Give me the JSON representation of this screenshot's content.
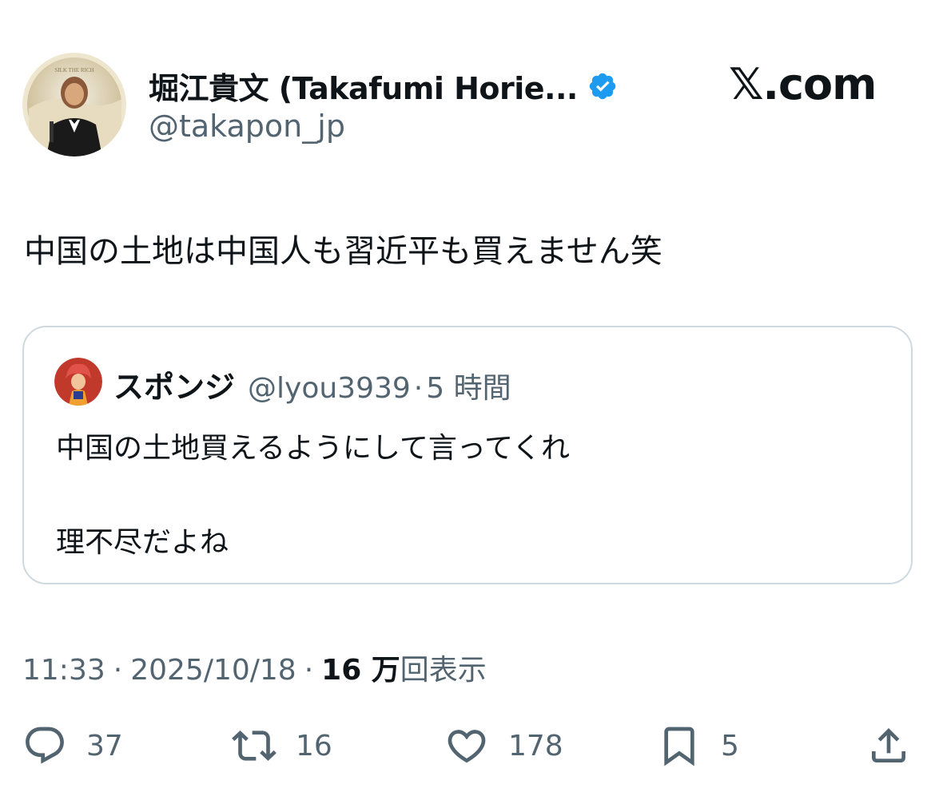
{
  "author": {
    "display_name": "堀江貴文 (Takafumi Horie...",
    "handle": "@takapon_jp",
    "avatar_text": "SILK THE RICH"
  },
  "site_label": "𝕏.com",
  "tweet": {
    "text": "中国の土地は中国人も習近平も買えません笑",
    "time": "11:33",
    "date": "2025/10/18",
    "views_count": "16 万",
    "views_label": "回表示"
  },
  "quote": {
    "name": "スポンジ",
    "handle": "@lyou3939",
    "separator": "·",
    "time": "5 時間",
    "line1": "中国の土地買えるようにして言ってくれ",
    "line2": "理不尽だよね"
  },
  "actions": {
    "reply_count": "37",
    "retweet_count": "16",
    "like_count": "178",
    "bookmark_count": "5"
  },
  "colors": {
    "text": "#0f1419",
    "secondary": "#536471",
    "verified": "#1d9bf0",
    "border": "#cfd9de"
  },
  "icons": [
    "verified-badge-icon",
    "reply-icon",
    "retweet-icon",
    "like-icon",
    "bookmark-icon",
    "share-icon"
  ]
}
